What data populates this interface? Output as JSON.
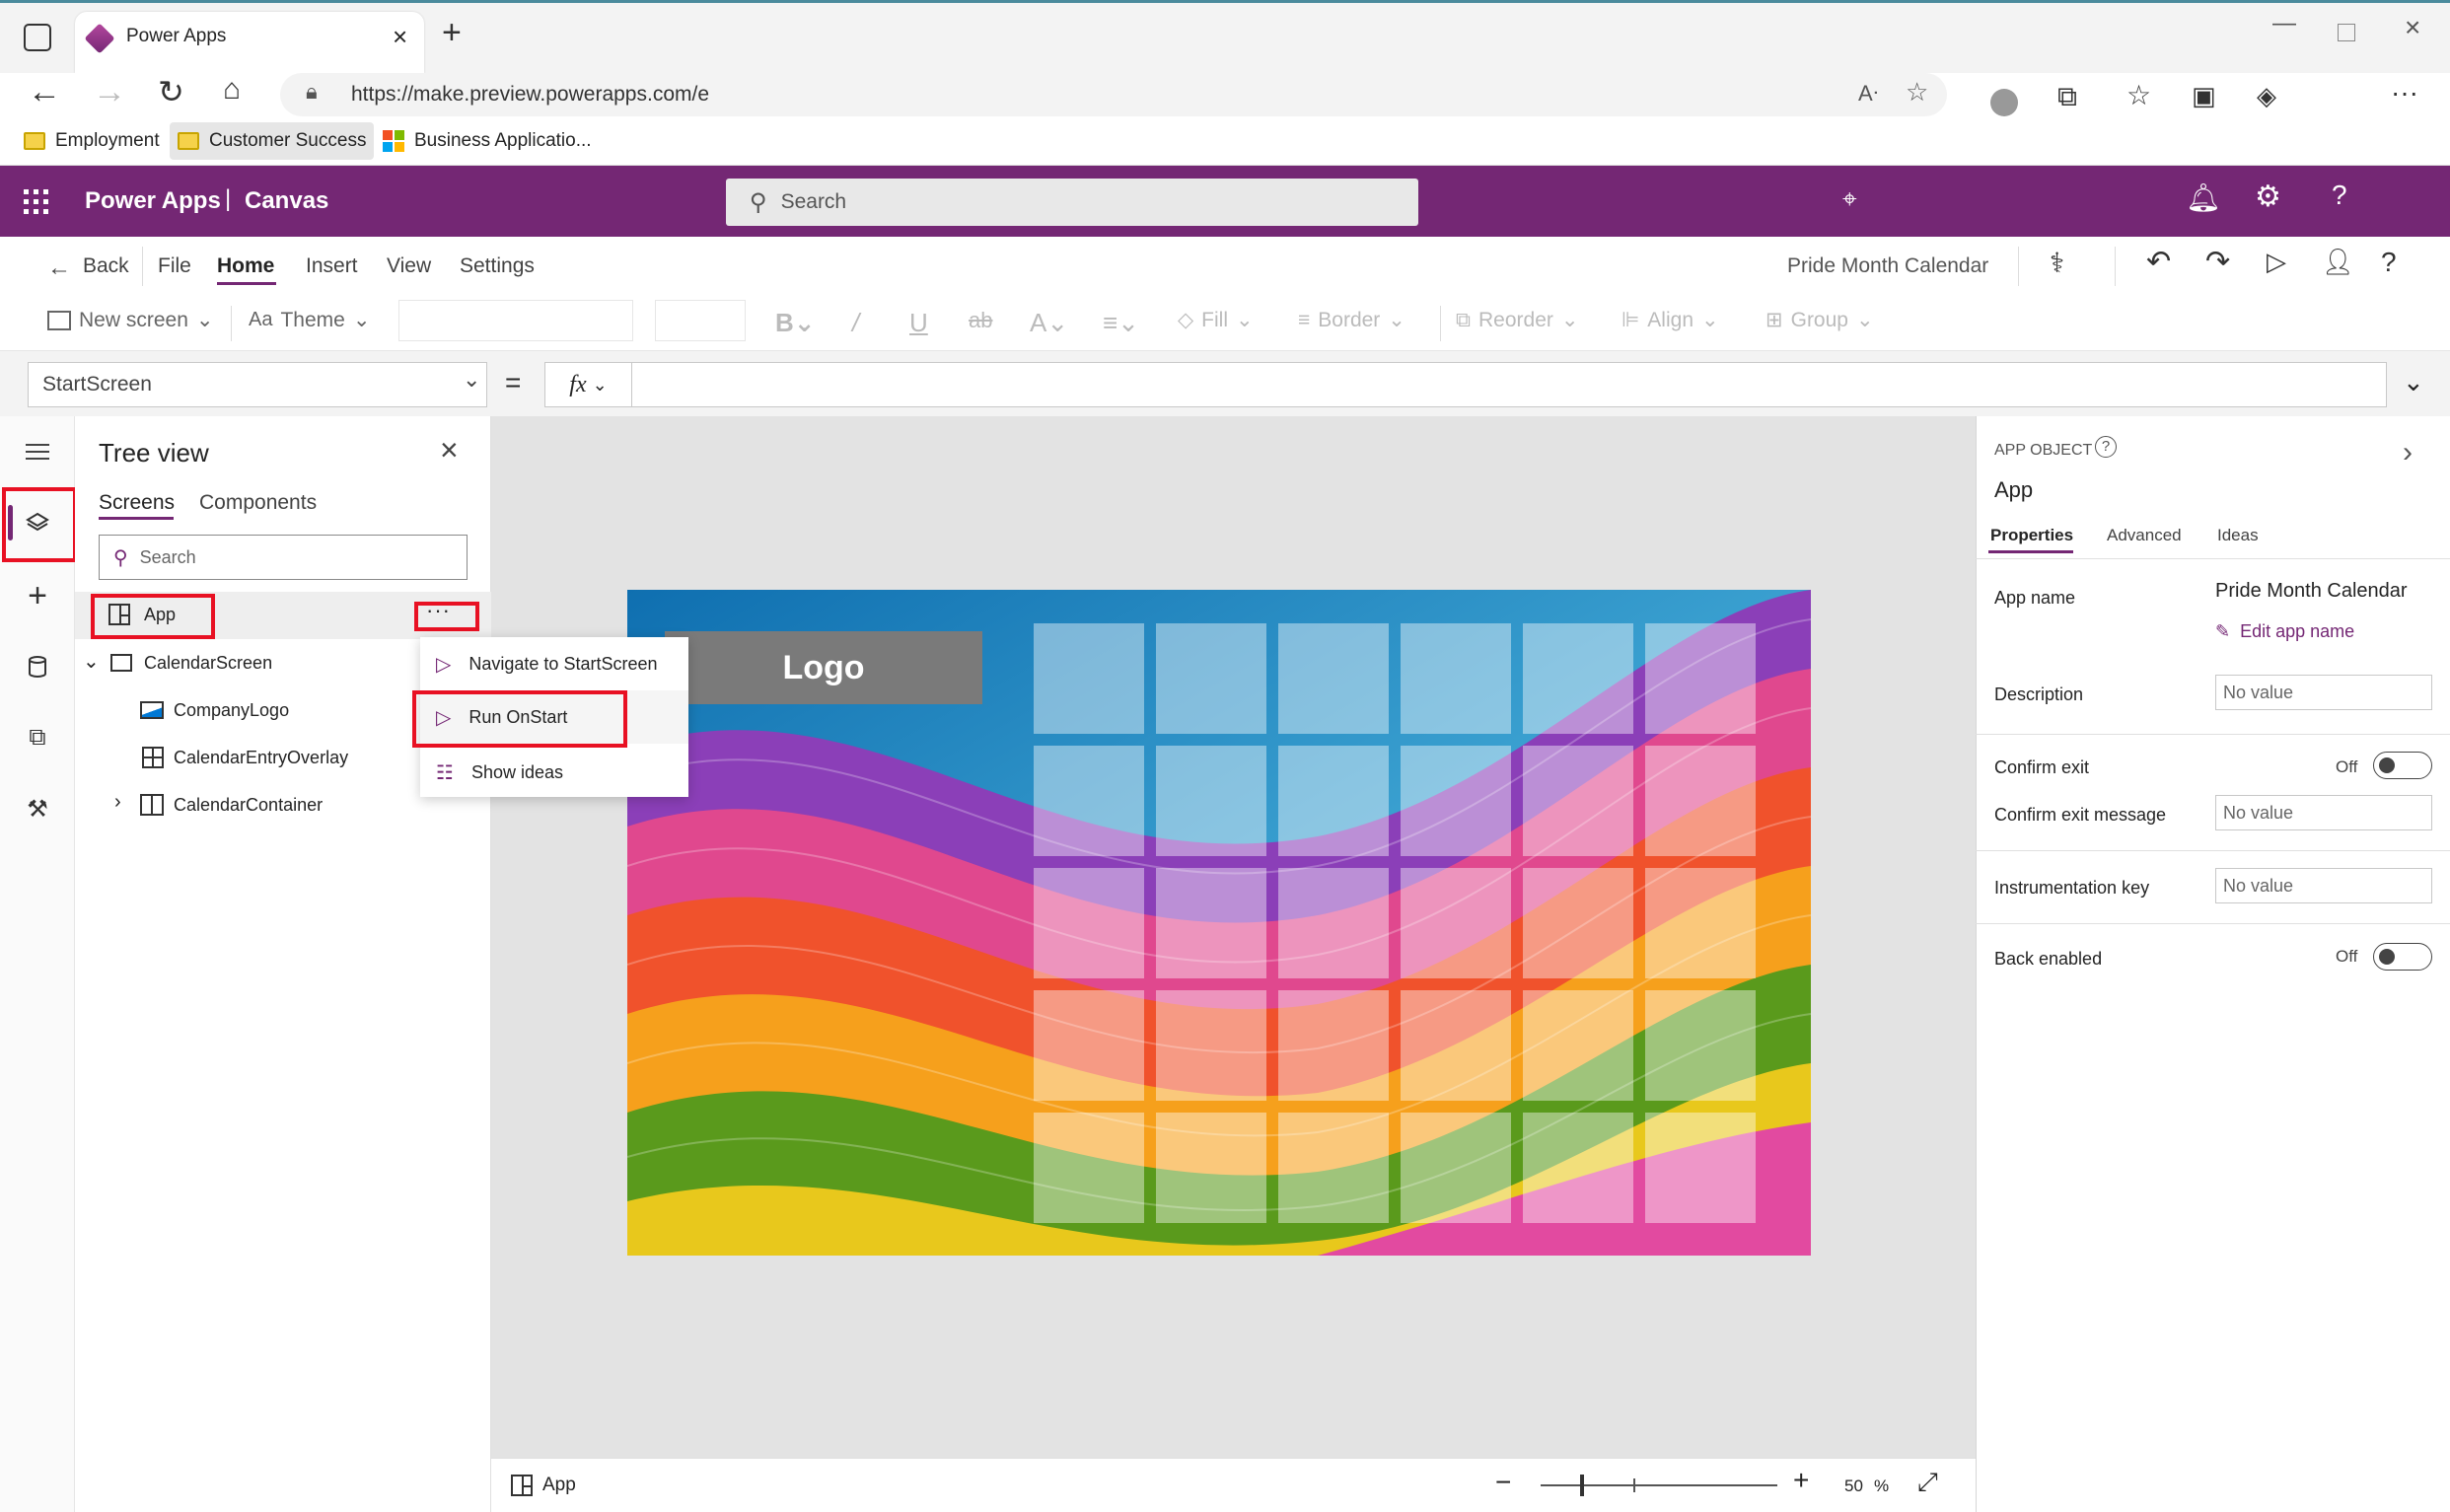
{
  "browser": {
    "tab_title": "Power Apps",
    "url": "https://make.preview.powerapps.com/e",
    "bookmarks": [
      {
        "label": "Employment",
        "icon": "folder-icon"
      },
      {
        "label": "Customer Success",
        "icon": "folder-icon"
      },
      {
        "label": "Business Applicatio...",
        "icon": "microsoft-logo-icon"
      }
    ]
  },
  "header": {
    "product": "Power Apps",
    "separator": "|",
    "mode": "Canvas",
    "search_placeholder": "Search"
  },
  "command_bar": {
    "back": "Back",
    "menus": [
      "File",
      "Home",
      "Insert",
      "View",
      "Settings"
    ],
    "active_menu": "Home",
    "app_name": "Pride Month Calendar"
  },
  "ribbon": {
    "new_screen": "New screen",
    "theme": "Theme",
    "fill": "Fill",
    "border": "Border",
    "reorder": "Reorder",
    "align": "Align",
    "group": "Group"
  },
  "formula_bar": {
    "property": "StartScreen",
    "equals": "=",
    "fx": "fx",
    "formula": ""
  },
  "tree_view": {
    "title": "Tree view",
    "tabs": [
      "Screens",
      "Components"
    ],
    "active_tab": "Screens",
    "search_placeholder": "Search",
    "items": [
      {
        "label": "App",
        "icon": "app-icon"
      },
      {
        "label": "CalendarScreen",
        "icon": "screen-icon"
      },
      {
        "label": "CompanyLogo",
        "icon": "image-icon"
      },
      {
        "label": "CalendarEntryOverlay",
        "icon": "gallery-icon"
      },
      {
        "label": "CalendarContainer",
        "icon": "container-icon"
      }
    ],
    "more_label": "···"
  },
  "context_menu": {
    "items": [
      {
        "label": "Navigate to StartScreen",
        "icon": "play-icon"
      },
      {
        "label": "Run OnStart",
        "icon": "play-icon"
      },
      {
        "label": "Show ideas",
        "icon": "ideas-icon"
      }
    ]
  },
  "canvas": {
    "logo_text": "Logo",
    "grid_rows": 5,
    "grid_cols": 6,
    "colors": {
      "bg": "#e3e3e3",
      "logo_box": "#7a7a7a"
    }
  },
  "status_bar": {
    "selected": "App",
    "zoom": "50",
    "zoom_unit": "%",
    "zoom_level": 0.5
  },
  "properties": {
    "object_type": "APP OBJECT",
    "object_name": "App",
    "tabs": [
      "Properties",
      "Advanced",
      "Ideas"
    ],
    "active_tab": "Properties",
    "app_name_label": "App name",
    "app_name_value": "Pride Month Calendar",
    "edit_app_name": "Edit app name",
    "description_label": "Description",
    "description_value": "No value",
    "confirm_exit_label": "Confirm exit",
    "confirm_exit_state": "Off",
    "confirm_exit_message_label": "Confirm exit message",
    "confirm_exit_message_value": "No value",
    "instrumentation_key_label": "Instrumentation key",
    "instrumentation_key_value": "No value",
    "back_enabled_label": "Back enabled",
    "back_enabled_state": "Off"
  },
  "colors": {
    "brand": "#742774",
    "highlight": "#e81123",
    "accent": "#5b2d86"
  }
}
